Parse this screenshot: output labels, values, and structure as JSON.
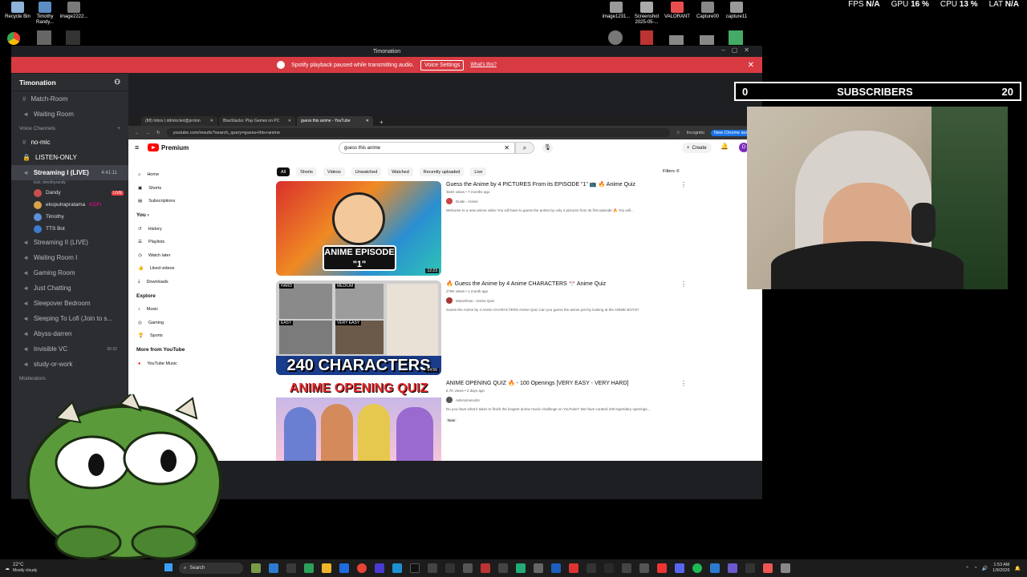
{
  "desktop": {
    "icons_left": [
      {
        "label": "Recycle Bin",
        "color": "#8fb3d9"
      },
      {
        "label": "Timothy Randy...",
        "color": "#5b8cc2"
      },
      {
        "label": "image2222...",
        "color": "#7a7a7a"
      }
    ],
    "icons_right": [
      {
        "label": "image1231...",
        "color": "#9a9a9a"
      },
      {
        "label": "Screenshot 2025-05-...",
        "color": "#aaaaaa"
      },
      {
        "label": "VALORANT",
        "color": "#e94e4e"
      },
      {
        "label": "Capture00",
        "color": "#888888"
      },
      {
        "label": "capture11",
        "color": "#999999"
      }
    ]
  },
  "stats": {
    "fps_label": "FPS",
    "fps_value": "N/A",
    "gpu_label": "GPU",
    "gpu_value": "16 %",
    "cpu_label": "CPU",
    "cpu_value": "13 %",
    "lat_label": "LAT",
    "lat_value": "N/A"
  },
  "discord": {
    "window_title": "Timonation",
    "banner_text": "Spotify playback paused while transmitting audio.",
    "banner_button": "Voice Settings",
    "banner_link": "What's this?",
    "server_name": "Timonation",
    "channels_top": [
      "Match-Room",
      "Waiting Room"
    ],
    "voice_category": "Voice Channels",
    "channels": [
      {
        "name": "no-mic",
        "icon": "#"
      },
      {
        "name": "LISTEN-ONLY",
        "icon": "lock"
      },
      {
        "name": "Streaming I (LIVE)",
        "icon": "speaker",
        "time": "4:41:11",
        "sub": "kick: timothyrandy"
      }
    ],
    "voice_users": [
      {
        "name": "Dandy",
        "color": "#c94f4f",
        "live": "LIVE"
      },
      {
        "name": "ekoputrapratama",
        "color": "#d9a14a",
        "extra": "KOFI"
      },
      {
        "name": "Timothy",
        "color": "#5d8fd9"
      },
      {
        "name": "TTS Bot",
        "color": "#3d7bd1"
      }
    ],
    "channels_bottom": [
      "Streaming II (LIVE)",
      "Waiting Room I",
      "Gaming Room",
      "Just Chatting",
      "Sleepover Bedroom",
      "Sleeping To Lofi (Join to s...",
      "Abyss-darren",
      "Invisible VC",
      "study-or-work"
    ],
    "invisible_counter": "00",
    "invisible_max": "02",
    "moderators_label": "Moderators"
  },
  "browser": {
    "tabs": [
      {
        "title": "(88) Inbox | ddmlocket@proton"
      },
      {
        "title": "BlueStacks: Play Games on PC"
      },
      {
        "title": "guess this anime - YouTube"
      }
    ],
    "url": "youtube.com/results?search_query=guess+this+anime",
    "incognito": "Incognito",
    "new_chrome": "New Chrome availa"
  },
  "youtube": {
    "logo": "Premium",
    "search_value": "guess this anime",
    "create_label": "Create",
    "account_initial": "D",
    "sidebar_main": [
      "Home",
      "Shorts",
      "Subscriptions"
    ],
    "you_label": "You",
    "sidebar_you": [
      "History",
      "Playlists",
      "Watch later",
      "Liked videos",
      "Downloads"
    ],
    "explore_label": "Explore",
    "sidebar_explore": [
      "Music",
      "Gaming",
      "Sports"
    ],
    "more_label": "More from YouTube",
    "sidebar_more": [
      "YouTube Music"
    ],
    "chips": [
      "All",
      "Shorts",
      "Videos",
      "Unwatched",
      "Watched",
      "Recently uploaded",
      "Live"
    ],
    "filters_label": "Filters",
    "videos": [
      {
        "title": "Guess the Anime by 4 PICTURES From its EPISODE \"1\" 📺 🔥 Anime Quiz",
        "meta": "464K views • 7 months ago",
        "channel": "Duski - Anime",
        "desc": "Welcome to a new anime video You will have to guess the anime by only 4 pictures from its first episode 🔥 You will...",
        "thumb_text": "ANIME EPISODE \"1\"",
        "duration": "12:23"
      },
      {
        "title": "🔥 Guess the Anime by 4 Anime CHARACTERS 🎌 Anime Quiz",
        "meta": "279K views • 1 month ago",
        "channel": "MotoShow - Anime Quiz",
        "desc": "Guess the Anime by 4 Anime CHARACTERS Anime Quiz Can you guess the anime just by looking at the ANIME BOYS?",
        "thumb_text": "240 CHARACTERS",
        "thumb_tags": [
          "HARD",
          "MEDIUM",
          "EASY",
          "VERY EASY"
        ],
        "duration": "14:56"
      },
      {
        "title": "ANIME OPENING QUIZ 🔥 - 100 Openings [VERY EASY - VERY HARD]",
        "meta": "6.7K views • 2 days ago",
        "channel": "AdsAnimeLists",
        "desc": "Do you have what it takes to finish the longest anime music challenge on YouTube? We have curated 100 legendary openings...",
        "badge": "New",
        "thumb_text": "ANIME OPENING QUIZ"
      }
    ]
  },
  "overlay": {
    "subs_left": "0",
    "subs_label": "SUBSCRIBERS",
    "subs_right": "20"
  },
  "taskbar": {
    "weather_temp": "22°C",
    "weather_desc": "Mostly cloudy",
    "search_label": "Search",
    "time": "1:53 AM",
    "date": "1/9/2026"
  },
  "colors": {
    "discord_banner": "#d83a42",
    "youtube_red": "#ff0000",
    "mascot_green": "#5a9a3a"
  }
}
